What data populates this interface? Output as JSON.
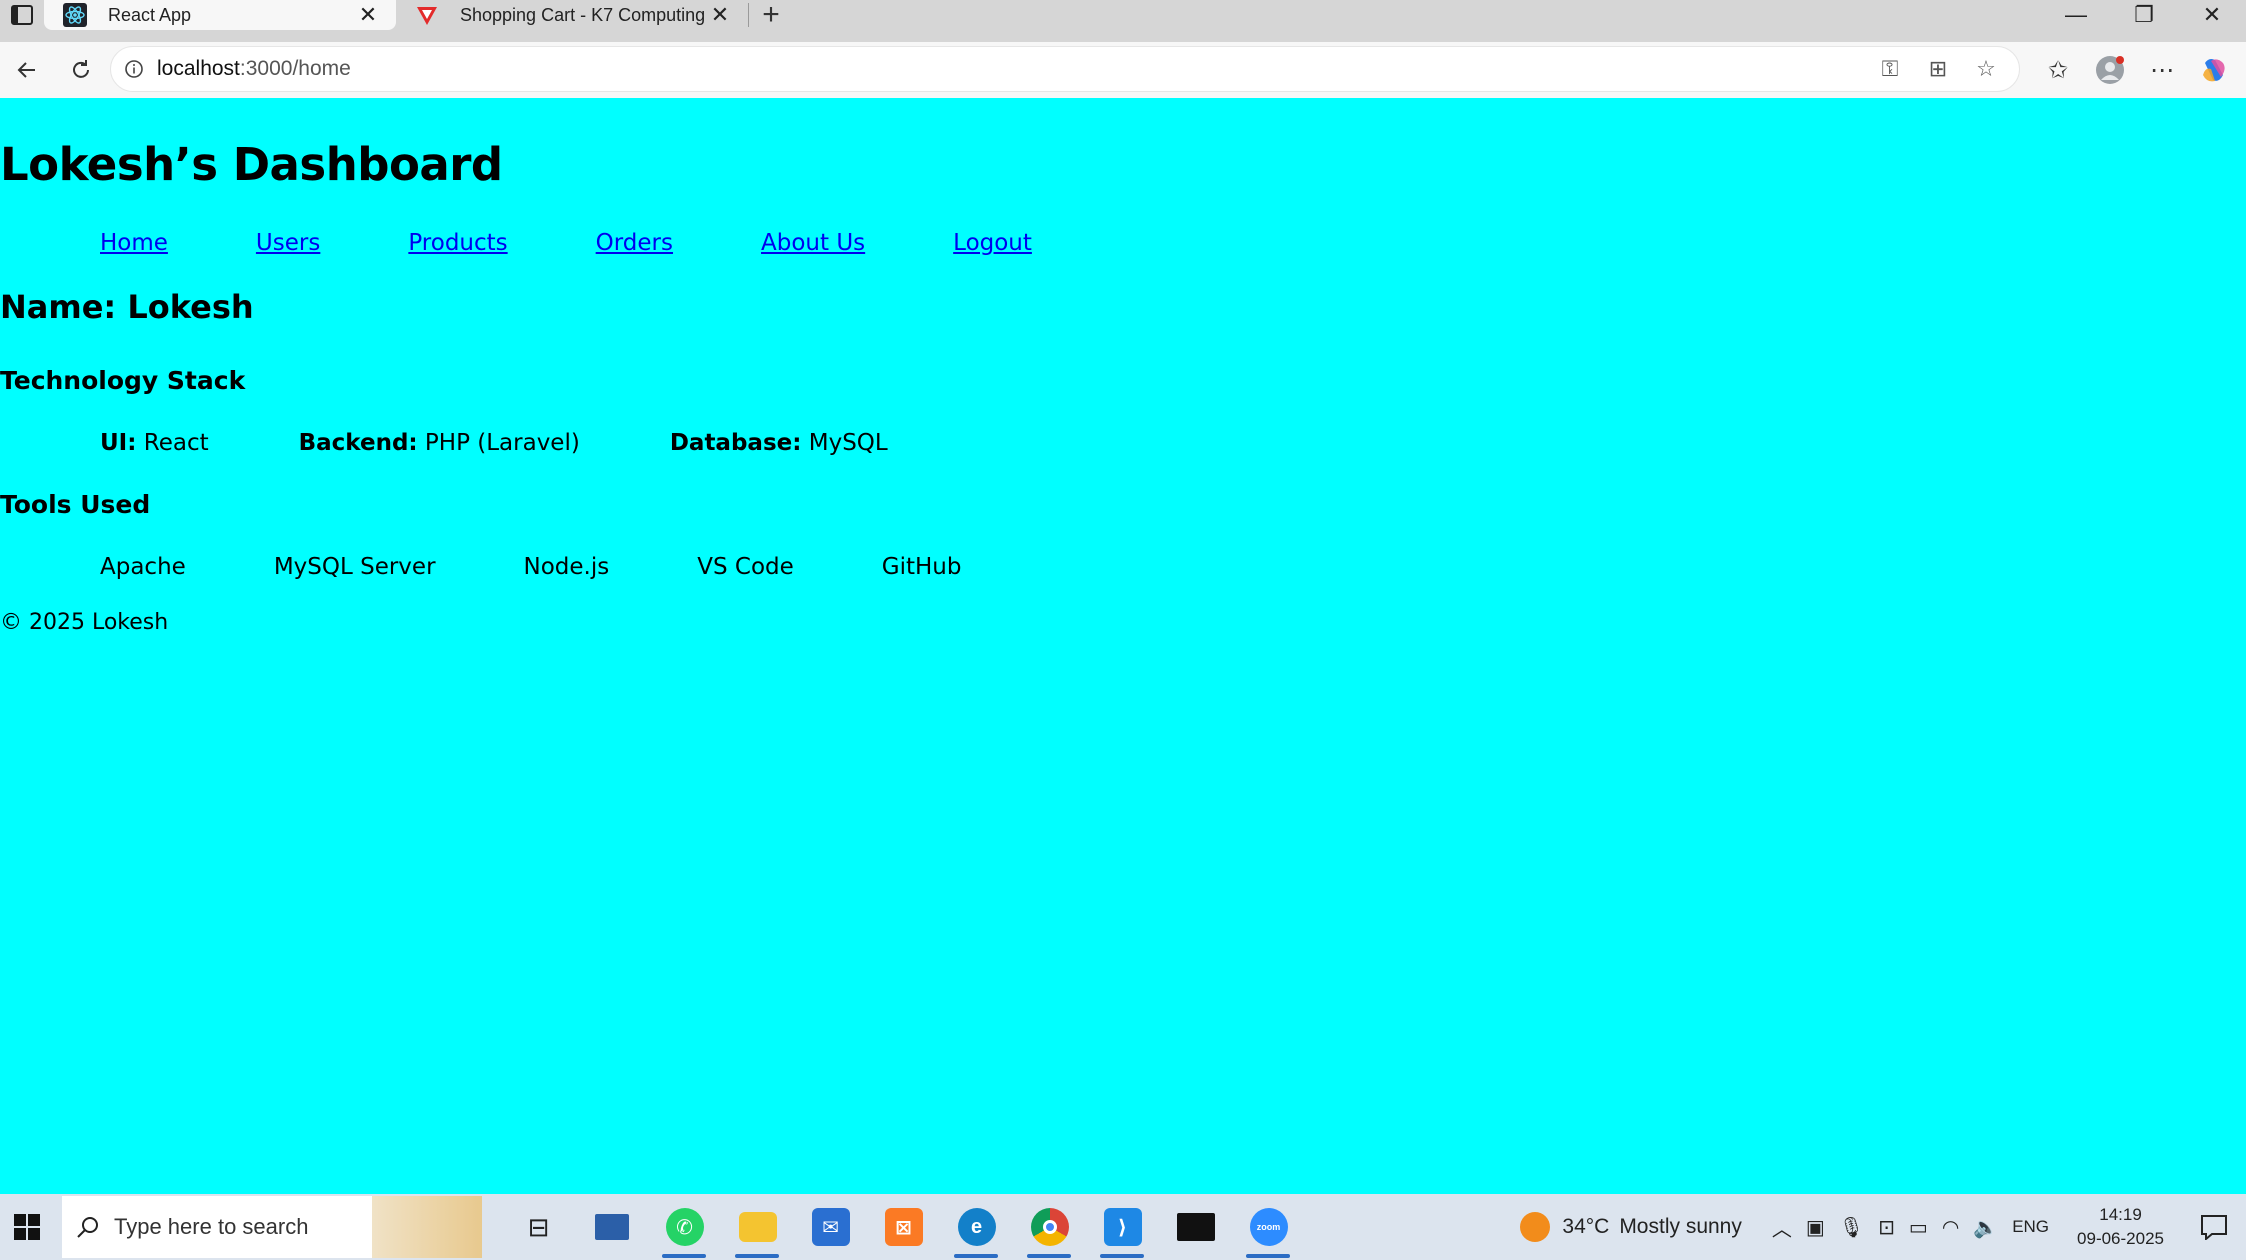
{
  "browser": {
    "tabs": [
      {
        "title": "React App",
        "icon": "react-favicon-icon",
        "active": true
      },
      {
        "title": "Shopping Cart - K7 Computing",
        "icon": "k7-favicon-icon",
        "active": false
      }
    ],
    "url_host": "localhost",
    "url_rest": ":3000/home"
  },
  "page": {
    "title": "Lokesh’s Dashboard",
    "nav": [
      "Home",
      "Users",
      "Products",
      "Orders",
      "About Us",
      "Logout"
    ],
    "name_line": "Name: Lokesh",
    "tech_heading": "Technology Stack",
    "tech": [
      {
        "label": "UI:",
        "value": "React"
      },
      {
        "label": "Backend:",
        "value": "PHP (Laravel)"
      },
      {
        "label": "Database:",
        "value": "MySQL"
      }
    ],
    "tools_heading": "Tools Used",
    "tools": [
      "Apache",
      "MySQL Server",
      "Node.js",
      "VS Code",
      "GitHub"
    ],
    "footer": "© 2025 Lokesh"
  },
  "taskbar": {
    "search_placeholder": "Type here to search",
    "weather_temp": "34°C",
    "weather_text": "Mostly sunny",
    "lang": "ENG",
    "time": "14:19",
    "date": "09-06-2025"
  },
  "colors": {
    "page_bg": "#00ffff",
    "link": "#0000ee"
  }
}
